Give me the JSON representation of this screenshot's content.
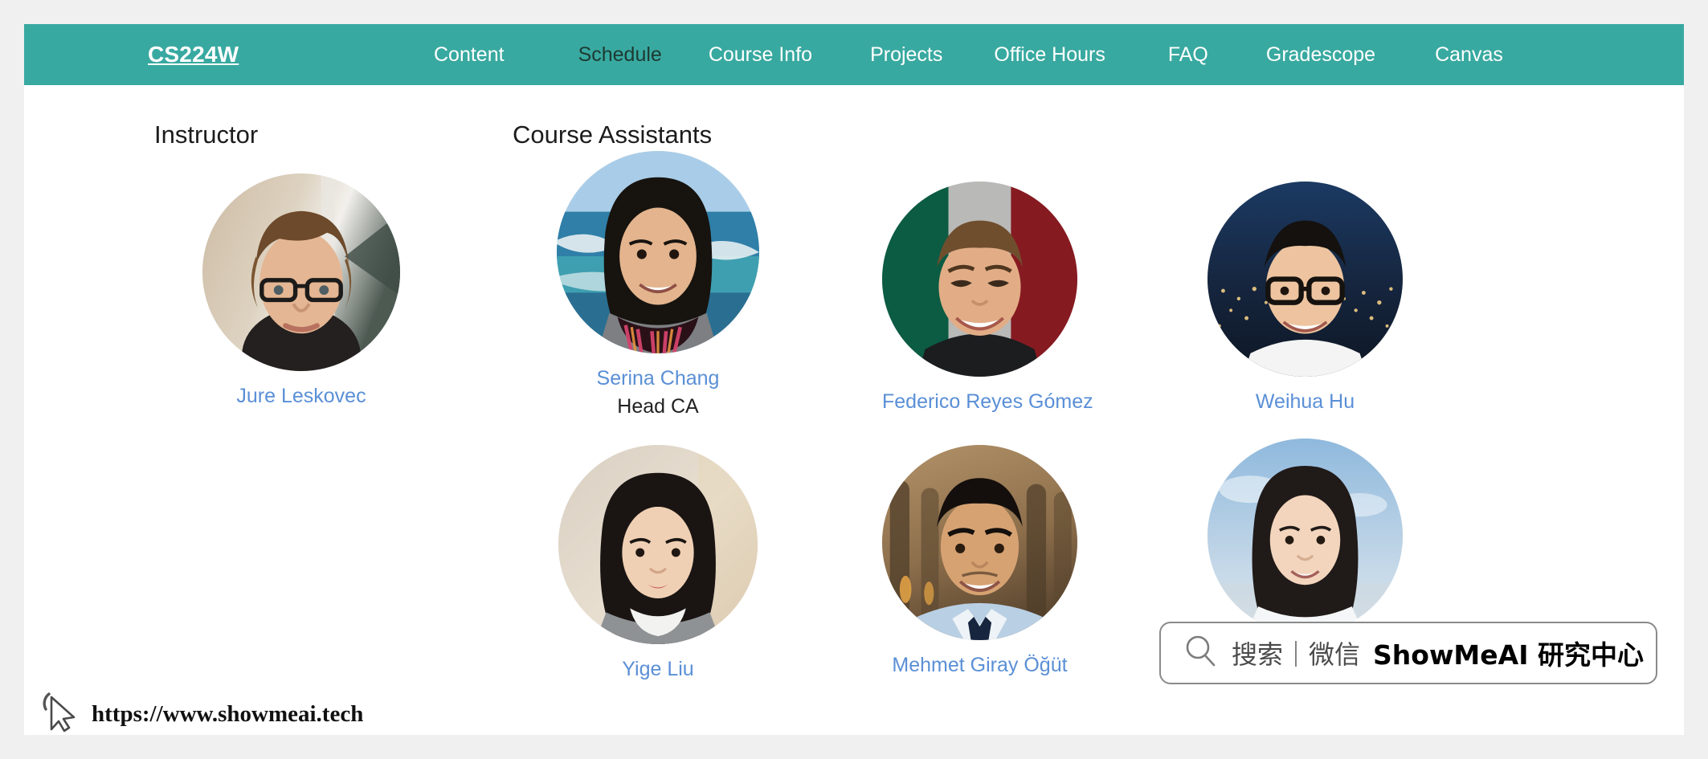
{
  "navbar": {
    "brand": "CS224W",
    "links": [
      {
        "label": "Content",
        "active": false
      },
      {
        "label": "Schedule",
        "active": true
      },
      {
        "label": "Course Info",
        "active": false
      },
      {
        "label": "Projects",
        "active": false
      },
      {
        "label": "Office Hours",
        "active": false
      },
      {
        "label": "FAQ",
        "active": false
      },
      {
        "label": "Gradescope",
        "active": false
      },
      {
        "label": "Canvas",
        "active": false
      }
    ],
    "background_color": "#38a9a0",
    "text_color": "#ffffff",
    "active_text_color": "#1d3a33"
  },
  "sections": {
    "instructor_heading": "Instructor",
    "assistants_heading": "Course Assistants"
  },
  "instructor": {
    "name": "Jure Leskovec",
    "photo": "jure-leskovec-portrait"
  },
  "assistants": [
    {
      "name": "Serina Chang",
      "role": "Head CA",
      "photo": "serina-chang-portrait"
    },
    {
      "name": "Federico Reyes Gómez",
      "role": "",
      "photo": "federico-reyes-gomez-portrait"
    },
    {
      "name": "Weihua Hu",
      "role": "",
      "photo": "weihua-hu-portrait"
    },
    {
      "name": "Yige Liu",
      "role": "",
      "photo": "yige-liu-portrait"
    },
    {
      "name": "Mehmet Giray Öğüt",
      "role": "",
      "photo": "mehmet-giray-ogut-portrait"
    },
    {
      "name": "",
      "role": "",
      "photo": "course-assistant-portrait"
    }
  ],
  "link_color": "#5a8fd6",
  "watermarks": {
    "url": "https://www.showmeai.tech",
    "search_cn": "搜索｜微信",
    "search_brand": "ShowMeAI 研究中心"
  }
}
